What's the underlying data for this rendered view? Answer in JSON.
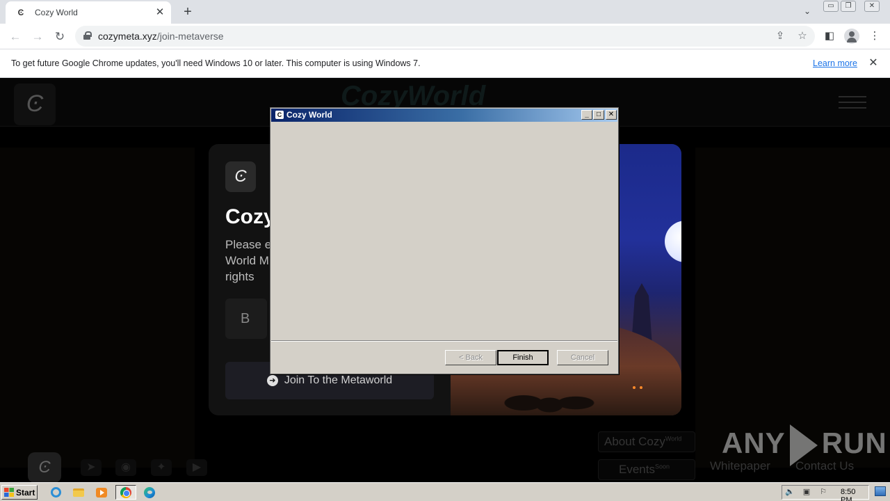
{
  "browser": {
    "tab": {
      "favicon": "Ͼ",
      "title": "Cozy World",
      "close": "✕"
    },
    "new_tab": "+",
    "tab_dropdown": "⌄",
    "window_controls": {
      "minimize": "▭",
      "restore": "❐",
      "close": "✕"
    },
    "nav": {
      "back": "←",
      "forward": "→",
      "reload": "↻"
    },
    "url": {
      "host": "cozymeta.xyz",
      "path": "/join-metaverse"
    },
    "omnibox_icons": {
      "share": "⇪",
      "bookmark": "☆"
    },
    "toolbar_icons": {
      "sidepanel": "◧",
      "menu": "⋮"
    }
  },
  "infobar": {
    "message": "To get future Google Chrome updates, you'll need Windows 10 or later. This computer is using Windows 7.",
    "link": "Learn more",
    "close": "✕"
  },
  "webpage": {
    "logo_glyph": "Ͼ",
    "card": {
      "title": "Cozy",
      "description_lines": [
        "Please e",
        "World M",
        "rights"
      ],
      "field_text": "B",
      "join_button": "Join To the Metaworld",
      "join_arrow": "➜"
    },
    "footer": {
      "social_icons": [
        "telegram-icon",
        "discord-icon",
        "twitter-icon",
        "youtube-icon"
      ],
      "social_glyphs": [
        "➤",
        "◉",
        "✦",
        "▶"
      ],
      "links": [
        {
          "label": "About Cozy",
          "sup": "World"
        },
        {
          "label": "Events",
          "sup": "Soon"
        },
        {
          "label": "Whitepaper",
          "sup": ""
        },
        {
          "label": "Contact Us",
          "sup": ""
        }
      ]
    }
  },
  "dialog": {
    "icon": "C",
    "title": "Cozy World",
    "controls": {
      "minimize": "_",
      "maximize": "□",
      "close": "✕"
    },
    "buttons": {
      "back": "< Back",
      "finish": "Finish",
      "cancel": "Cancel"
    }
  },
  "taskbar": {
    "start": "Start",
    "apps": [
      "internet-explorer",
      "file-explorer",
      "media-player",
      "chrome",
      "edge"
    ],
    "tray_icons": {
      "volume": "🔈",
      "network": "▣",
      "flag": "⚐"
    },
    "clock": "8:50 PM"
  },
  "watermark": {
    "left": "ANY",
    "right": "RUN"
  }
}
